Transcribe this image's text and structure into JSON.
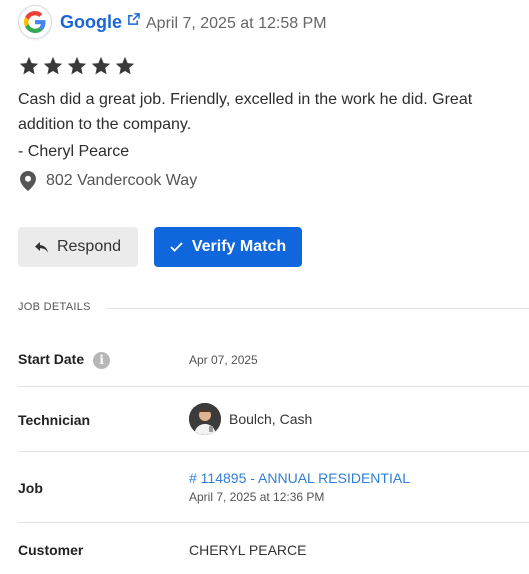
{
  "review": {
    "source": "Google",
    "timestamp": "April 7, 2025 at 12:58 PM",
    "rating": 5,
    "rating_max": 5,
    "text": "Cash did a great job. Friendly,  excelled in the work he did. Great addition to the company.",
    "author": "- Cheryl Pearce",
    "location": "802 Vandercook Way"
  },
  "actions": {
    "respond_label": "Respond",
    "verify_label": "Verify Match"
  },
  "job_details": {
    "section_title": "JOB DETAILS",
    "start_date_label": "Start Date",
    "start_date_value": "Apr 07, 2025",
    "technician_label": "Technician",
    "technician_value": "Boulch, Cash",
    "job_label": "Job",
    "job_link": "# 114895 - ANNUAL RESIDENTIAL",
    "job_date": "April 7, 2025 at 12:36 PM",
    "customer_label": "Customer",
    "customer_value": "CHERYL PEARCE"
  },
  "icons": {
    "source_logo": "google-logo-icon",
    "external": "external-link-icon",
    "star": "star-icon",
    "location": "map-pin-icon",
    "respond": "reply-icon",
    "verify": "check-icon",
    "info": "info-icon"
  },
  "colors": {
    "link": "#1a66d6",
    "primary_button": "#1066db",
    "star": "#3a3a3a",
    "job_link": "#2f7fd6"
  }
}
